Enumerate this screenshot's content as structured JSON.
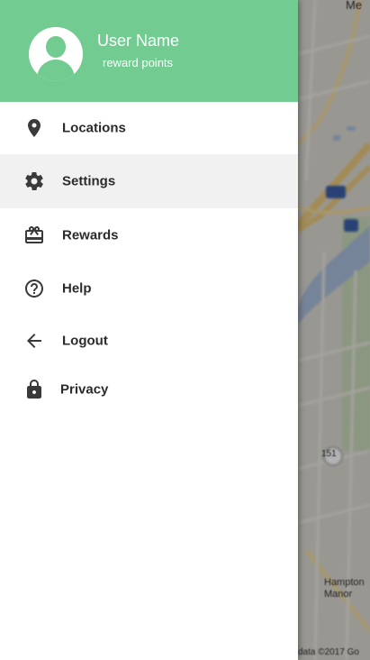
{
  "map": {
    "top_label": "Me",
    "shield_label": "151",
    "town_label": "Hampton Manor",
    "copyright": "data ©2017 Go"
  },
  "drawer": {
    "header": {
      "user_name": "User Name",
      "reward_points": "reward points",
      "accent_color": "#72cc91"
    },
    "items": [
      {
        "label": "Locations",
        "icon": "location-pin-icon",
        "active": false
      },
      {
        "label": "Settings",
        "icon": "gear-icon",
        "active": true
      },
      {
        "label": "Rewards",
        "icon": "gift-card-icon",
        "active": false
      },
      {
        "label": "Help",
        "icon": "help-circle-icon",
        "active": false
      },
      {
        "label": "Logout",
        "icon": "arrow-left-icon",
        "active": false
      },
      {
        "label": "Privacy",
        "icon": "lock-icon",
        "active": false
      }
    ]
  }
}
